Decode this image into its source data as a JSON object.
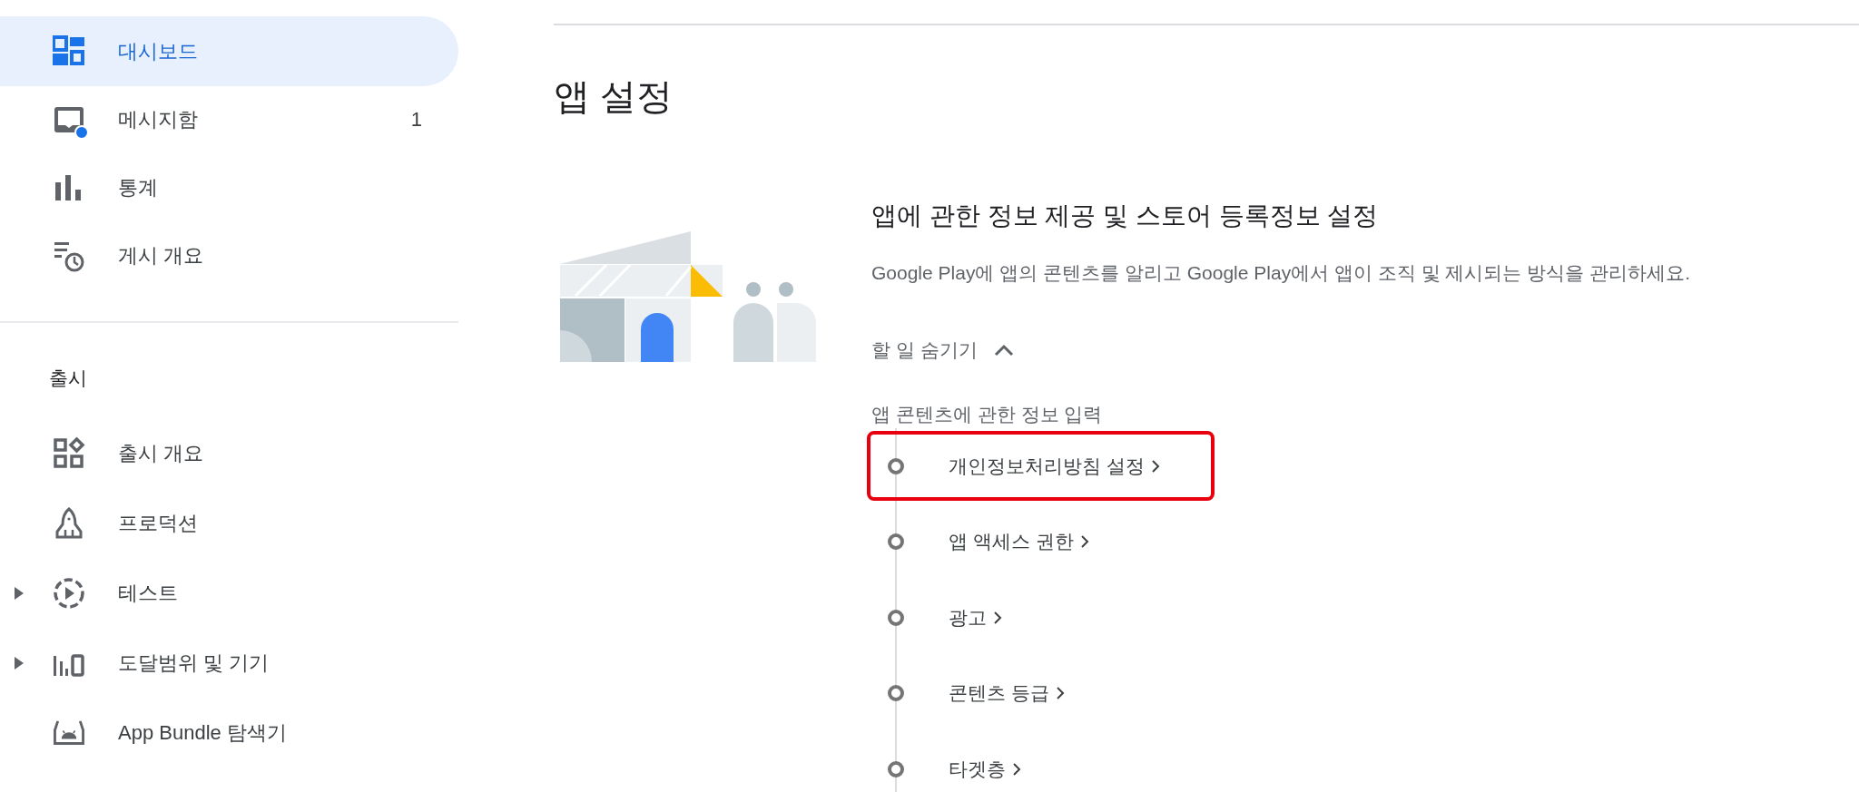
{
  "sidebar": {
    "items": [
      {
        "label": "대시보드",
        "selected": true,
        "unread": false
      },
      {
        "label": "메시지함",
        "selected": false,
        "unread": true,
        "count": "1"
      },
      {
        "label": "통계",
        "selected": false,
        "unread": false
      },
      {
        "label": "게시 개요",
        "selected": false,
        "unread": false
      }
    ],
    "release": {
      "title": "출시",
      "items": [
        {
          "label": "출시 개요",
          "selected": false,
          "expandable": false
        },
        {
          "label": "프로덕션",
          "selected": false,
          "expandable": false
        },
        {
          "label": "테스트",
          "selected": false,
          "expandable": true
        },
        {
          "label": "도달범위 및 기기",
          "selected": false,
          "expandable": true
        },
        {
          "label": "App Bundle 탐색기",
          "selected": false,
          "expandable": false
        }
      ]
    }
  },
  "page_title": "앱 설정",
  "setup": {
    "title": "앱에 관한 정보 제공 및 스토어 등록정보 설정",
    "description": "Google Play에 앱의 콘텐츠를 알리고 Google Play에서 앱이 조직 및 제시되는 방식을 관리하세요.",
    "toggle": {
      "label": "할 일 숨기기",
      "expanded": true
    },
    "tasks_heading": "앱 콘텐츠에 관한 정보 입력",
    "tasks": [
      {
        "label": "개인정보처리방침 설정",
        "highlighted": true
      },
      {
        "label": "앱 액세스 권한",
        "highlighted": false
      },
      {
        "label": "광고",
        "highlighted": false
      },
      {
        "label": "콘텐츠 등급",
        "highlighted": false
      },
      {
        "label": "타겟층",
        "highlighted": false
      }
    ]
  }
}
